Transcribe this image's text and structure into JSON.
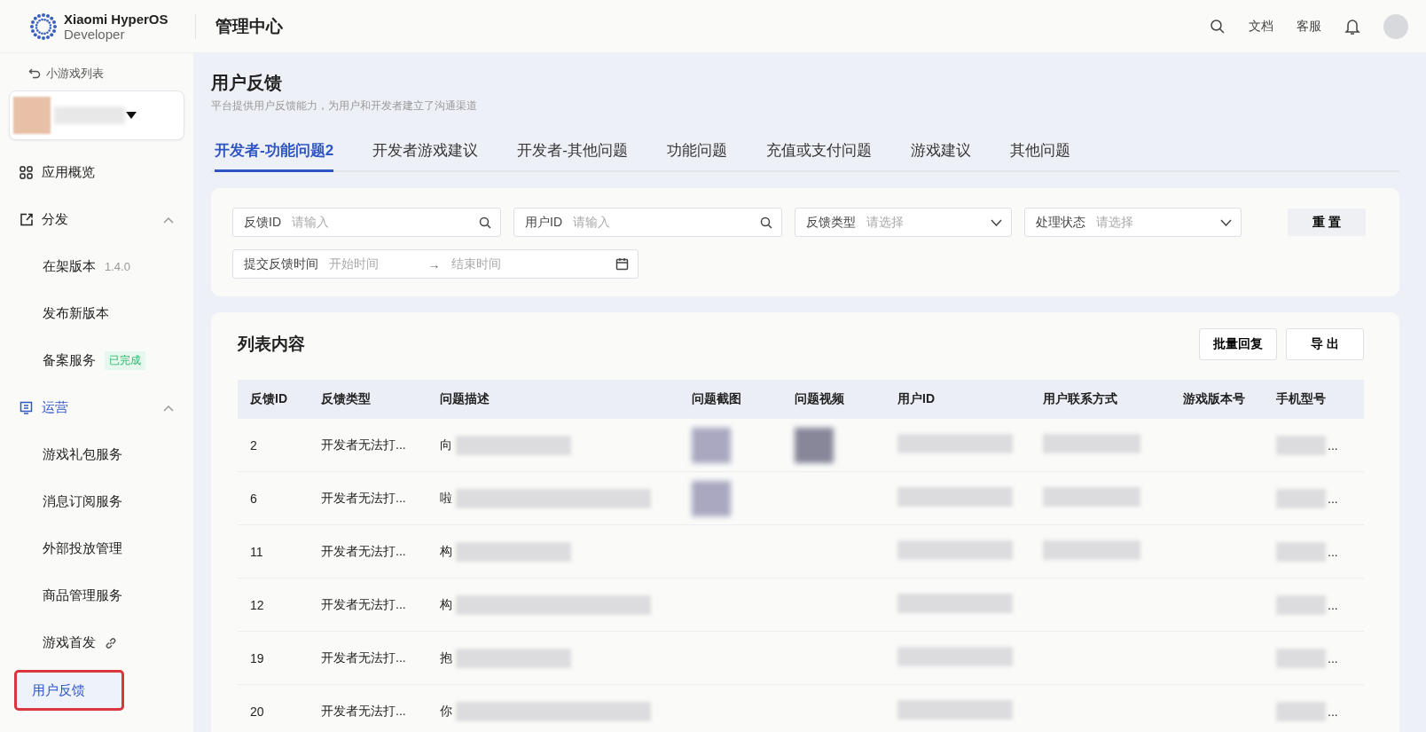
{
  "header": {
    "brand": "Xiaomi HyperOS",
    "brand_sub": "Developer",
    "section": "管理中心",
    "links": [
      "文档",
      "客服"
    ]
  },
  "sidebar": {
    "back": "小游戏列表",
    "nav": [
      {
        "label": "应用概览"
      },
      {
        "label": "分发",
        "expanded": true,
        "children": [
          {
            "label": "在架版本",
            "note": "1.4.0",
            "selected": false
          },
          {
            "label": "发布新版本",
            "selected": false
          },
          {
            "label": "备案服务",
            "badge": "已完成",
            "selected": false
          }
        ]
      },
      {
        "label": "运营",
        "expanded": true,
        "children": [
          {
            "label": "游戏礼包服务",
            "selected": false
          },
          {
            "label": "消息订阅服务",
            "selected": false
          },
          {
            "label": "外部投放管理",
            "selected": false
          },
          {
            "label": "商品管理服务",
            "selected": false
          },
          {
            "label": "游戏首发",
            "link": true,
            "selected": false
          },
          {
            "label": "用户反馈",
            "selected": true,
            "annotated": true
          }
        ]
      }
    ]
  },
  "page": {
    "title": "用户反馈",
    "subtitle": "平台提供用户反馈能力，为用户和开发者建立了沟通渠道"
  },
  "tabs": [
    {
      "label": "开发者-功能问题2",
      "selected": true
    },
    {
      "label": "开发者游戏建议",
      "selected": false
    },
    {
      "label": "开发者-其他问题",
      "selected": false
    },
    {
      "label": "功能问题",
      "selected": false
    },
    {
      "label": "充值或支付问题",
      "selected": false
    },
    {
      "label": "游戏建议",
      "selected": false
    },
    {
      "label": "其他问题",
      "selected": false
    }
  ],
  "filters": [
    {
      "kind": "search",
      "label": "反馈ID",
      "placeholder": "请输入"
    },
    {
      "kind": "search",
      "label": "用户ID",
      "placeholder": "请输入"
    },
    {
      "kind": "select",
      "label": "反馈类型",
      "placeholder": "请选择"
    },
    {
      "kind": "select",
      "label": "处理状态",
      "placeholder": "请选择"
    },
    {
      "kind": "daterange",
      "label": "提交反馈时间",
      "placeholder": "开始时间",
      "separator": "→",
      "end_placeholder": "结束时间"
    }
  ],
  "reset_button": "重 置",
  "list": {
    "title": "列表内容",
    "buttons": [
      "批量回复",
      "导 出"
    ],
    "columns": [
      "反馈ID",
      "反馈类型",
      "问题描述",
      "问题截图",
      "问题视频",
      "用户ID",
      "用户联系方式",
      "游戏版本号",
      "手机型号"
    ],
    "rows": [
      {
        "id": "2",
        "type": "开发者无法打...",
        "description": "向",
        "screenshot": true,
        "video": true,
        "model": "..."
      },
      {
        "id": "6",
        "type": "开发者无法打...",
        "description": "啦",
        "screenshot": true,
        "video": false,
        "model": "..."
      },
      {
        "id": "11",
        "type": "开发者无法打...",
        "description": "构",
        "screenshot": false,
        "video": false,
        "model": "..."
      },
      {
        "id": "12",
        "type": "开发者无法打...",
        "description": "构",
        "screenshot": false,
        "video": false,
        "model": "..."
      },
      {
        "id": "19",
        "type": "开发者无法打...",
        "description": "抱",
        "screenshot": false,
        "video": false,
        "model": "..."
      },
      {
        "id": "20",
        "type": "开发者无法打...",
        "description": "你",
        "screenshot": false,
        "video": false,
        "model": "..."
      }
    ]
  }
}
